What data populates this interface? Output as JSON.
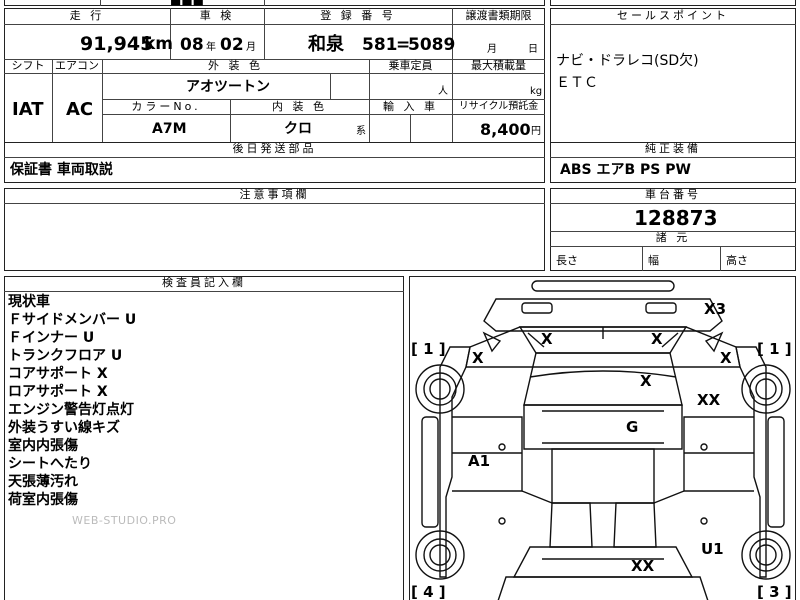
{
  "top_partial": {
    "fragment": "■■■"
  },
  "mileage": {
    "header": "走 行",
    "value": "91,945",
    "unit": "km"
  },
  "inspection": {
    "header": "車 検",
    "year": "08",
    "year_unit": "年",
    "month": "02",
    "month_unit": "月"
  },
  "registration": {
    "header": "登 録 番 号",
    "area": "和泉",
    "class_no": "581",
    "sep": "=",
    "number": "5089"
  },
  "transfer_deadline": {
    "header": "譲渡書類期限",
    "month_unit": "月",
    "day_unit": "日"
  },
  "selling_points": {
    "header": "セールスポイント",
    "lines": [
      "ナビ・ドラレコ(SD欠)",
      "ＥＴＣ"
    ]
  },
  "shift": {
    "header": "シフト",
    "value": "IAT"
  },
  "aircon": {
    "header": "エアコン",
    "value": "AC"
  },
  "exterior_color": {
    "header": "外 装 色",
    "value": "アオツートン"
  },
  "capacity": {
    "header": "乗車定員",
    "unit": "人"
  },
  "max_load": {
    "header": "最大積載量",
    "unit": "kg"
  },
  "color_no": {
    "header": "カラーNo.",
    "value": "A7M"
  },
  "interior_color": {
    "header": "内 装 色",
    "value": "クロ",
    "suffix": "系"
  },
  "imported": {
    "header": "輸 入 車"
  },
  "recycle": {
    "header": "リサイクル預託金",
    "value": "8,400",
    "unit": "円"
  },
  "later_parts": {
    "header": "後日発送部品",
    "value": "保証書 車両取説"
  },
  "standard_equipment": {
    "header": "純正装備",
    "value": "ABS エアB PS PW"
  },
  "notes": {
    "header": "注意事項欄"
  },
  "chassis": {
    "header": "車台番号",
    "value": "128873"
  },
  "dimensions": {
    "header": "諸 元",
    "length": "長さ",
    "width": "幅",
    "height": "高さ"
  },
  "inspector": {
    "header": "検査員記入欄",
    "lines": [
      "現状車",
      "Ｆサイドメンバー U",
      "Ｆインナー U",
      "トランクフロア U",
      "コアサポート X",
      "ロアサポート X",
      "エンジン警告灯点灯",
      "外装うすい線キズ",
      "室内内張傷",
      "シートへたり",
      "天張薄汚れ",
      "荷室内張傷"
    ]
  },
  "watermark": "WEB-STUDIO.PRO",
  "diagram": {
    "marks": {
      "x3": "X3",
      "x_left_front_bumper": "X",
      "x_right_front_bumper": "X",
      "x_left_fender": "X",
      "x_right_fender": "X",
      "x_hood": "X",
      "xx_right": "XX",
      "g_roof": "G",
      "a1_left": "A1",
      "xx_rear": "XX",
      "u1_right": "U1"
    },
    "brackets": {
      "left_top": "[ 1 ]",
      "right_top": "[ 1 ]",
      "left_bottom": "[ 4 ]",
      "right_bottom": "[ 3 ]"
    }
  }
}
